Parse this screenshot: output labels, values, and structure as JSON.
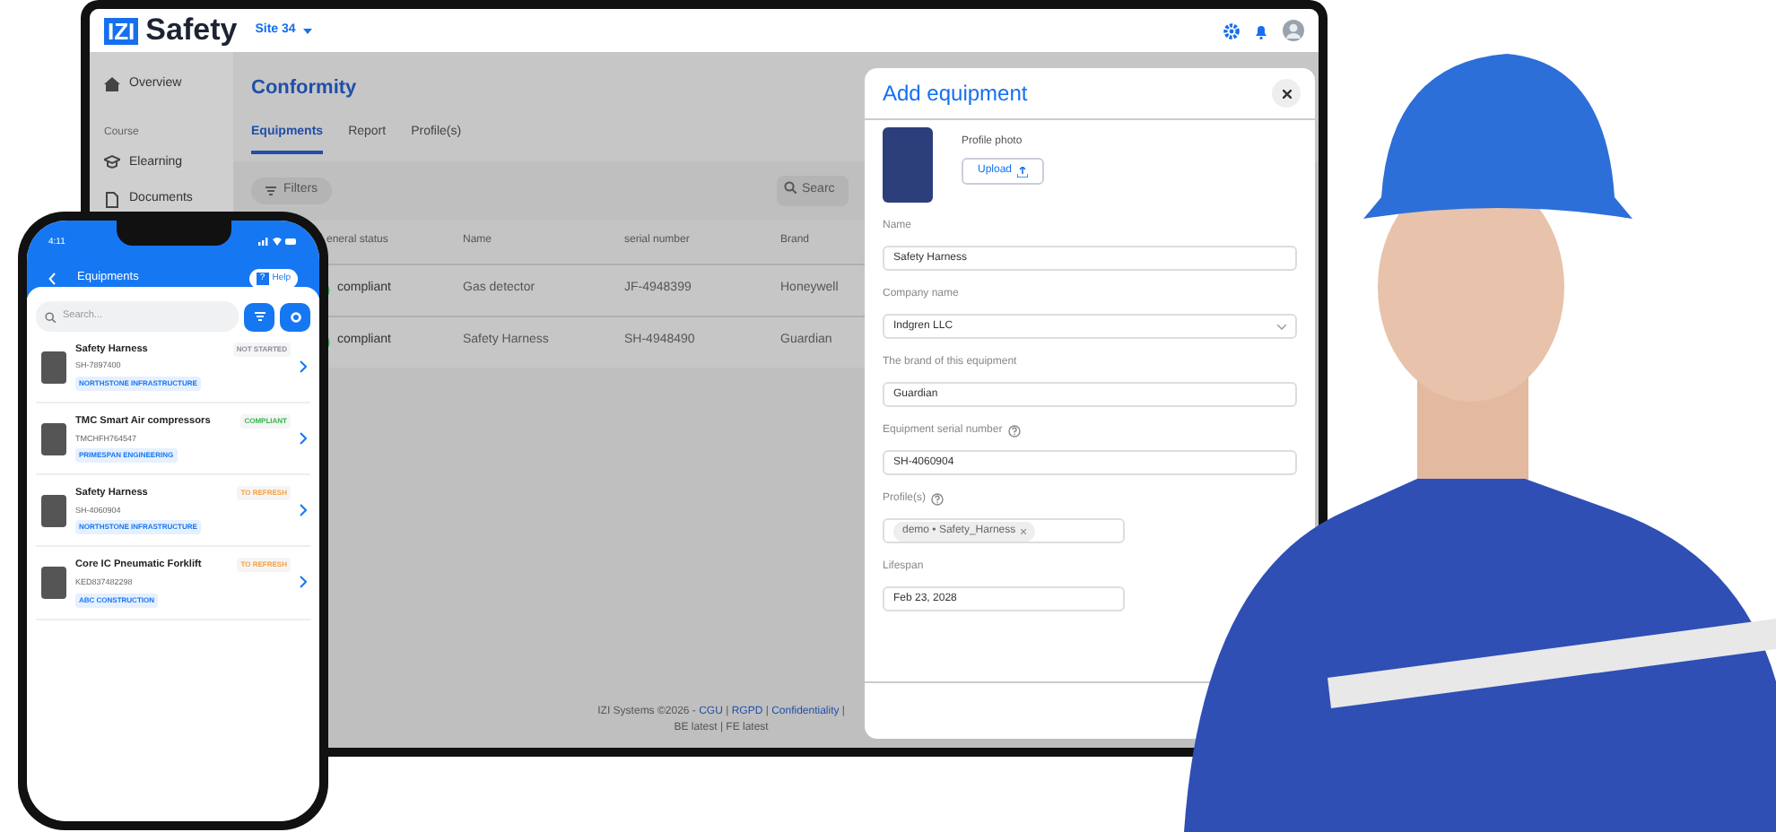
{
  "laptop": {
    "logo": {
      "mark": "IZI",
      "text": "Safety"
    },
    "site": "Site 34",
    "sidebar": [
      {
        "kind": "item",
        "label": "Overview"
      },
      {
        "kind": "section",
        "label": "Course"
      },
      {
        "kind": "item",
        "label": "Elearning"
      },
      {
        "kind": "item",
        "label": "Documents"
      }
    ],
    "page_title": "Conformity",
    "tabs": [
      {
        "label": "Equipments",
        "selected": true
      },
      {
        "label": "Report",
        "selected": false
      },
      {
        "label": "Profile(s)",
        "selected": false
      }
    ],
    "filters_button": "Filters",
    "search": {
      "placeholder": "Searc"
    },
    "table": {
      "columns": [
        "eneral status",
        "Name",
        "serial number",
        "Brand"
      ],
      "rows": [
        {
          "status": "compliant",
          "name": "Gas detector",
          "serial": "JF-4948399",
          "brand": "Honeywell"
        },
        {
          "status": "compliant",
          "name": "Safety Harness",
          "serial": "SH-4948490",
          "brand": "Guardian"
        }
      ]
    },
    "footer": {
      "copyright": "IZI Systems ©2026 -",
      "links": [
        "CGU",
        "RGPD",
        "Confidentiality"
      ],
      "separator": "|",
      "versions": "BE latest | FE latest"
    }
  },
  "modal": {
    "title": "Add equipment",
    "photo_label": "Profile photo",
    "upload_button": "Upload",
    "fields": [
      {
        "kind": "text",
        "label": "Name",
        "help": false,
        "value": "Safety Harness"
      },
      {
        "kind": "select",
        "label": "Company name",
        "help": false,
        "value": "Indgren LLC"
      },
      {
        "kind": "text",
        "label": "The brand of this equipment",
        "help": false,
        "value": "Guardian"
      },
      {
        "kind": "text",
        "label": "Equipment serial number",
        "help": true,
        "value": "SH-4060904"
      },
      {
        "kind": "tags",
        "label": "Profile(s)",
        "help": true,
        "tags": [
          "demo • Safety_Harness"
        ]
      },
      {
        "kind": "date",
        "label": "Lifespan",
        "help": false,
        "value": "Feb 23, 2028"
      }
    ]
  },
  "phone": {
    "time": "4:11",
    "title": "Equipments",
    "help_button": "Help",
    "help_icon": "?",
    "search": {
      "placeholder": "Search..."
    },
    "items": [
      {
        "name": "Safety Harness",
        "serial": "SH-7897400",
        "status": "NOT STARTED",
        "color": "#8a8f98",
        "company": "NORTHSTONE INFRASTRUCTURE"
      },
      {
        "name": "TMC Smart Air compressors",
        "serial": "TMCHFH764547",
        "status": "COMPLIANT",
        "color": "#2fb84a",
        "company": "PRIMESPAN ENGINEERING"
      },
      {
        "name": "Safety Harness",
        "serial": "SH-4060904",
        "status": "TO REFRESH",
        "color": "#f5a043",
        "company": "NORTHSTONE INFRASTRUCTURE"
      },
      {
        "name": "Core IC Pneumatic Forklift",
        "serial": "KED837482298",
        "status": "TO REFRESH",
        "color": "#f5a043",
        "company": "ABC CONSTRUCTION"
      }
    ]
  }
}
